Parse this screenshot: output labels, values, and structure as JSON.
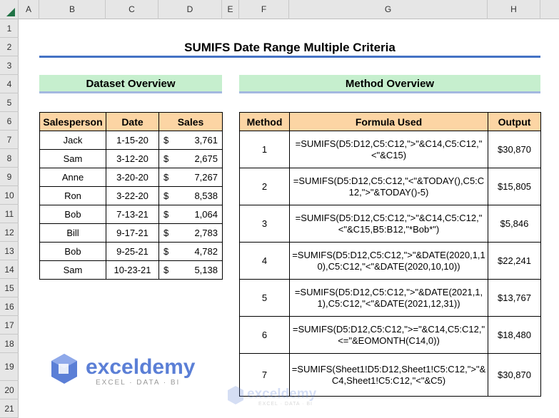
{
  "columns": [
    "A",
    "B",
    "C",
    "D",
    "E",
    "F",
    "G",
    "H"
  ],
  "rows": [
    "1",
    "2",
    "3",
    "4",
    "5",
    "6",
    "7",
    "8",
    "9",
    "10",
    "11",
    "12",
    "13",
    "14",
    "15",
    "16",
    "17",
    "18",
    "19",
    "20",
    "21"
  ],
  "title": "SUMIFS Date Range Multiple Criteria",
  "dataset": {
    "heading": "Dataset Overview",
    "headers": [
      "Salesperson",
      "Date",
      "Sales"
    ],
    "currency": "$",
    "rows": [
      {
        "name": "Jack",
        "date": "1-15-20",
        "sales": "3,761"
      },
      {
        "name": "Sam",
        "date": "3-12-20",
        "sales": "2,675"
      },
      {
        "name": "Anne",
        "date": "3-20-20",
        "sales": "7,267"
      },
      {
        "name": "Ron",
        "date": "3-22-20",
        "sales": "8,538"
      },
      {
        "name": "Bob",
        "date": "7-13-21",
        "sales": "1,064"
      },
      {
        "name": "Bill",
        "date": "9-17-21",
        "sales": "2,783"
      },
      {
        "name": "Bob",
        "date": "9-25-21",
        "sales": "4,782"
      },
      {
        "name": "Sam",
        "date": "10-23-21",
        "sales": "5,138"
      }
    ]
  },
  "methods": {
    "heading": "Method Overview",
    "headers": [
      "Method",
      "Formula Used",
      "Output"
    ],
    "rows": [
      {
        "n": "1",
        "formula": "=SUMIFS(D5:D12,C5:C12,\">\"&C14,C5:C12,\"<\"&C15)",
        "out": "$30,870"
      },
      {
        "n": "2",
        "formula": "=SUMIFS(D5:D12,C5:C12,\"<\"&TODAY(),C5:C12,\">\"&TODAY()-5)",
        "out": "$15,805"
      },
      {
        "n": "3",
        "formula": "=SUMIFS(D5:D12,C5:C12,\">\"&C14,C5:C12,\"<\"&C15,B5:B12,\"*Bob*\")",
        "out": "$5,846"
      },
      {
        "n": "4",
        "formula": "=SUMIFS(D5:D12,C5:C12,\">\"&DATE(2020,1,10),C5:C12,\"<\"&DATE(2020,10,10))",
        "out": "$22,241"
      },
      {
        "n": "5",
        "formula": "=SUMIFS(D5:D12,C5:C12,\">\"&DATE(2021,1,1),C5:C12,\"<\"&DATE(2021,12,31))",
        "out": "$13,767"
      },
      {
        "n": "6",
        "formula": "=SUMIFS(D5:D12,C5:C12,\">=\"&C14,C5:C12,\"<=\"&EOMONTH(C14,0))",
        "out": "$18,480"
      },
      {
        "n": "7",
        "formula": "=SUMIFS(Sheet1!D5:D12,Sheet1!C5:C12,\">\"&C4,Sheet1!C5:C12,\"<\"&C5)",
        "out": "$30,870"
      }
    ]
  },
  "logo": {
    "name": "exceldemy",
    "tagline": "EXCEL · DATA · BI"
  }
}
